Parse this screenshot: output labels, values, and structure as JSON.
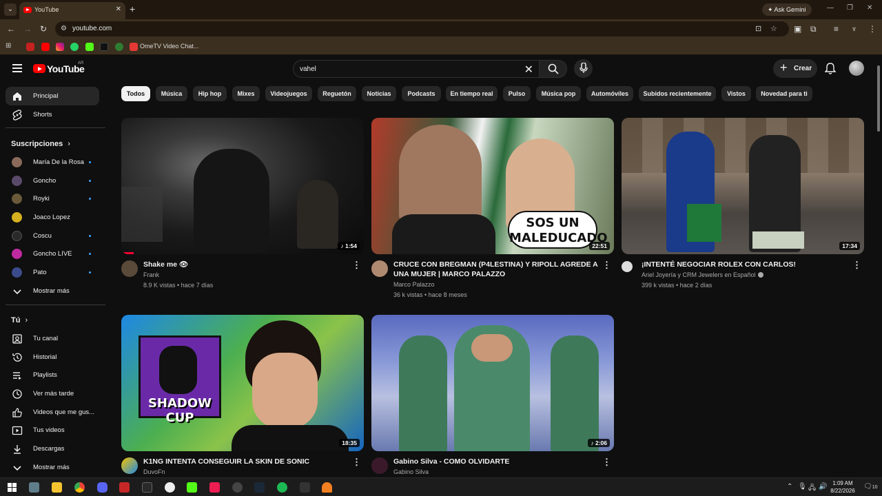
{
  "browser": {
    "tab_title": "YouTube",
    "url": "youtube.com",
    "ask_gemini": "Ask Gemini",
    "bookmark_label": "OmeTV Video Chat..."
  },
  "header": {
    "logo_text": "YouTube",
    "logo_region": "AR",
    "search_value": "vahel",
    "create_label": "Crear"
  },
  "sidebar": {
    "main": [
      {
        "label": "Principal",
        "icon": "home-icon"
      },
      {
        "label": "Shorts",
        "icon": "shorts-icon"
      }
    ],
    "subs_header": "Suscripciones",
    "subscriptions": [
      {
        "label": "María De la Rosa",
        "color": "#8a6a5a"
      },
      {
        "label": "Goncho",
        "color": "#5a4a6a"
      },
      {
        "label": "Royki",
        "color": "#6a5a3a"
      },
      {
        "label": "Joaco Lopez",
        "color": "#d4b020"
      },
      {
        "label": "Coscu",
        "color": "#2a2a2a"
      },
      {
        "label": "Goncho LIVE",
        "color": "#c02aa0"
      },
      {
        "label": "Pato",
        "color": "#3a4a8a"
      }
    ],
    "show_more": "Mostrar más",
    "you_header": "Tú",
    "you_items": [
      {
        "label": "Tu canal",
        "icon": "channel-icon"
      },
      {
        "label": "Historial",
        "icon": "history-icon"
      },
      {
        "label": "Playlists",
        "icon": "playlist-icon"
      },
      {
        "label": "Ver más tarde",
        "icon": "clock-icon"
      },
      {
        "label": "Videos que me gus...",
        "icon": "thumbs-up-icon"
      },
      {
        "label": "Tus videos",
        "icon": "your-videos-icon"
      },
      {
        "label": "Descargas",
        "icon": "download-icon"
      },
      {
        "label": "Mostrar más",
        "icon": "chevron-down-icon"
      }
    ]
  },
  "chips": [
    "Todos",
    "Música",
    "Hip hop",
    "Mixes",
    "Videojuegos",
    "Reguetón",
    "Noticias",
    "Podcasts",
    "En tiempo real",
    "Pulso",
    "Música pop",
    "Automóviles",
    "Subidos recientemente",
    "Vistos",
    "Novedad para ti"
  ],
  "videos": [
    {
      "title": "Shake me 👁",
      "channel": "Frank",
      "meta": "8.9 K vistas • hace 7 días",
      "duration": "♪ 1:54",
      "progress": 0.05
    },
    {
      "title": "CRUCE CON BREGMAN (P4LESTINA) Y RIPOLL AGREDE A UNA MUJER | MARCO PALAZZO",
      "channel": "Marco Palazzo",
      "meta": "36 k vistas • hace 8 meses",
      "duration": "22:51",
      "overlay": "SOS UN MALEDUCADO"
    },
    {
      "title": "¡INTENTÉ NEGOCIAR ROLEX CON CARLOS!",
      "channel": "Ariel Joyería y CRM Jewelers en Español",
      "meta": "399 k vistas • hace 2 días",
      "duration": "17:34"
    },
    {
      "title": "K1NG INTENTA CONSEGUIR LA SKIN DE SONIC",
      "channel": "DuvoFn",
      "meta": "",
      "duration": "18:35",
      "overlay": "SHADOW CUP"
    },
    {
      "title": "Gabino Silva - COMO OLVIDARTE",
      "channel": "Gabino Silva",
      "meta": "",
      "duration": "♪ 2:06"
    }
  ],
  "taskbar": {
    "time": "1:09 AM",
    "date": "8/22/2026",
    "notifications": "10"
  }
}
